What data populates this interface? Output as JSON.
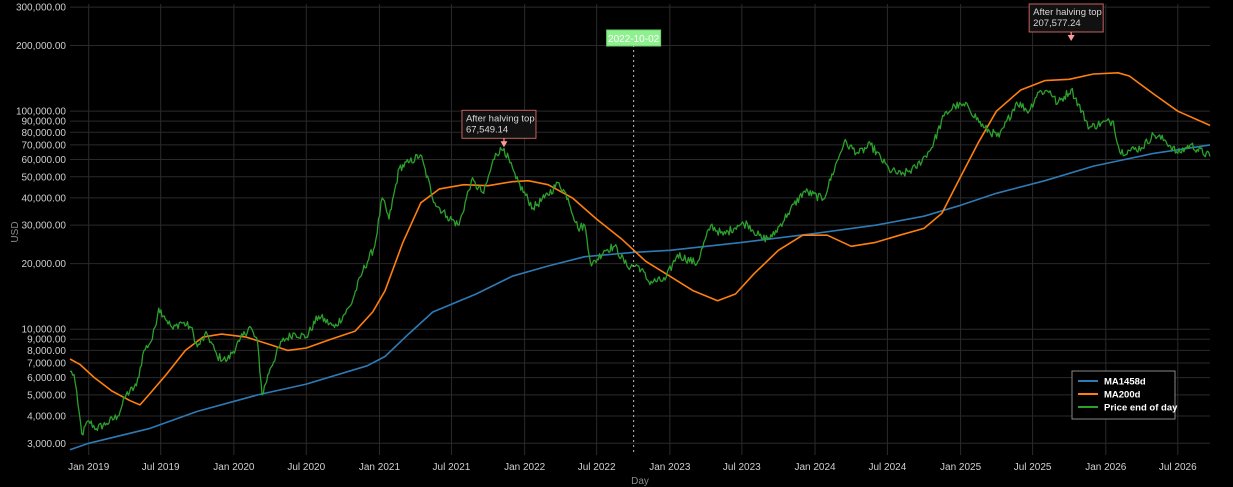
{
  "chart_data": {
    "type": "line",
    "xlabel": "Day",
    "ylabel": "USD",
    "y_scale": "log",
    "xlim": [
      "2018-11-15",
      "2026-09-20"
    ],
    "ylim": [
      2650,
      310000
    ],
    "grid": true,
    "legend_position": "bottom-right",
    "background": "#000000",
    "x_ticks": [
      {
        "date": "2019-01-01",
        "label": "Jan 2019"
      },
      {
        "date": "2019-07-01",
        "label": "Jul 2019"
      },
      {
        "date": "2020-01-01",
        "label": "Jan 2020"
      },
      {
        "date": "2020-07-01",
        "label": "Jul 2020"
      },
      {
        "date": "2021-01-01",
        "label": "Jan 2021"
      },
      {
        "date": "2021-07-01",
        "label": "Jul 2021"
      },
      {
        "date": "2022-01-01",
        "label": "Jan 2022"
      },
      {
        "date": "2022-07-01",
        "label": "Jul 2022"
      },
      {
        "date": "2023-01-01",
        "label": "Jan 2023"
      },
      {
        "date": "2023-07-01",
        "label": "Jul 2023"
      },
      {
        "date": "2024-01-01",
        "label": "Jan 2024"
      },
      {
        "date": "2024-07-01",
        "label": "Jul 2024"
      },
      {
        "date": "2025-01-01",
        "label": "Jan 2025"
      },
      {
        "date": "2025-07-01",
        "label": "Jul 2025"
      },
      {
        "date": "2026-01-01",
        "label": "Jan 2026"
      },
      {
        "date": "2026-07-01",
        "label": "Jul 2026"
      }
    ],
    "y_ticks": [
      {
        "value": 300000,
        "label": "300,000.00"
      },
      {
        "value": 200000,
        "label": "200,000.00"
      },
      {
        "value": 100000,
        "label": "100,000.00"
      },
      {
        "value": 90000,
        "label": "90,000.00"
      },
      {
        "value": 80000,
        "label": "80,000.00"
      },
      {
        "value": 70000,
        "label": "70,000.00"
      },
      {
        "value": 60000,
        "label": "60,000.00"
      },
      {
        "value": 50000,
        "label": "50,000.00"
      },
      {
        "value": 40000,
        "label": "40,000.00"
      },
      {
        "value": 30000,
        "label": "30,000.00"
      },
      {
        "value": 20000,
        "label": "20,000.00"
      },
      {
        "value": 10000,
        "label": "10,000.00"
      },
      {
        "value": 9000,
        "label": "9,000.00"
      },
      {
        "value": 8000,
        "label": "8,000.00"
      },
      {
        "value": 7000,
        "label": "7,000.00"
      },
      {
        "value": 6000,
        "label": "6,000.00"
      },
      {
        "value": 5000,
        "label": "5,000.00"
      },
      {
        "value": 4000,
        "label": "4,000.00"
      },
      {
        "value": 3000,
        "label": "3,000.00"
      }
    ],
    "series": [
      {
        "name": "MA1458d",
        "color": "#2e7ab5",
        "points": [
          [
            "2018-11-15",
            2800
          ],
          [
            "2019-01-01",
            3000
          ],
          [
            "2019-06-01",
            3500
          ],
          [
            "2019-10-01",
            4200
          ],
          [
            "2020-03-01",
            5000
          ],
          [
            "2020-07-01",
            5600
          ],
          [
            "2020-12-01",
            6800
          ],
          [
            "2021-01-15",
            7500
          ],
          [
            "2021-03-15",
            9500
          ],
          [
            "2021-05-15",
            12000
          ],
          [
            "2021-09-01",
            14500
          ],
          [
            "2021-12-01",
            17500
          ],
          [
            "2022-03-01",
            19500
          ],
          [
            "2022-06-01",
            21500
          ],
          [
            "2022-10-01",
            22500
          ],
          [
            "2023-01-01",
            23000
          ],
          [
            "2023-07-01",
            25000
          ],
          [
            "2024-01-01",
            27500
          ],
          [
            "2024-06-01",
            30000
          ],
          [
            "2024-10-01",
            33000
          ],
          [
            "2025-01-01",
            37000
          ],
          [
            "2025-04-01",
            42000
          ],
          [
            "2025-08-01",
            48000
          ],
          [
            "2025-12-01",
            56000
          ],
          [
            "2026-05-01",
            64000
          ],
          [
            "2026-09-20",
            70000
          ]
        ]
      },
      {
        "name": "MA200d",
        "color": "#ff7f0e",
        "points": [
          [
            "2018-11-15",
            7300
          ],
          [
            "2018-12-10",
            6900
          ],
          [
            "2019-01-15",
            6000
          ],
          [
            "2019-03-01",
            5200
          ],
          [
            "2019-04-15",
            4700
          ],
          [
            "2019-05-10",
            4500
          ],
          [
            "2019-06-01",
            5000
          ],
          [
            "2019-07-15",
            6200
          ],
          [
            "2019-09-01",
            8000
          ],
          [
            "2019-10-15",
            9200
          ],
          [
            "2019-12-01",
            9500
          ],
          [
            "2020-02-01",
            9200
          ],
          [
            "2020-04-01",
            8500
          ],
          [
            "2020-05-15",
            8000
          ],
          [
            "2020-07-01",
            8200
          ],
          [
            "2020-09-01",
            9000
          ],
          [
            "2020-11-01",
            9800
          ],
          [
            "2020-12-15",
            12000
          ],
          [
            "2021-01-15",
            15000
          ],
          [
            "2021-03-01",
            25000
          ],
          [
            "2021-04-15",
            38000
          ],
          [
            "2021-06-01",
            44000
          ],
          [
            "2021-08-01",
            46000
          ],
          [
            "2021-10-01",
            45500
          ],
          [
            "2021-12-01",
            47500
          ],
          [
            "2022-01-10",
            48000
          ],
          [
            "2022-03-01",
            46000
          ],
          [
            "2022-05-01",
            40000
          ],
          [
            "2022-07-01",
            32000
          ],
          [
            "2022-09-01",
            26000
          ],
          [
            "2022-11-01",
            20500
          ],
          [
            "2023-01-01",
            17500
          ],
          [
            "2023-03-01",
            15000
          ],
          [
            "2023-05-01",
            13500
          ],
          [
            "2023-06-15",
            14500
          ],
          [
            "2023-08-01",
            18000
          ],
          [
            "2023-10-01",
            23000
          ],
          [
            "2023-12-01",
            27000
          ],
          [
            "2024-02-01",
            27000
          ],
          [
            "2024-04-01",
            24000
          ],
          [
            "2024-06-01",
            25000
          ],
          [
            "2024-08-01",
            27000
          ],
          [
            "2024-10-01",
            29000
          ],
          [
            "2024-11-15",
            34000
          ],
          [
            "2025-01-01",
            50000
          ],
          [
            "2025-02-15",
            72000
          ],
          [
            "2025-04-01",
            100000
          ],
          [
            "2025-06-01",
            125000
          ],
          [
            "2025-08-01",
            138000
          ],
          [
            "2025-10-01",
            140000
          ],
          [
            "2025-12-01",
            148000
          ],
          [
            "2026-02-01",
            150000
          ],
          [
            "2026-03-01",
            145000
          ],
          [
            "2026-05-01",
            120000
          ],
          [
            "2026-07-01",
            100000
          ],
          [
            "2026-09-20",
            86000
          ]
        ]
      },
      {
        "name": "Price end of day",
        "color": "#2ca02c",
        "points": [
          [
            "2018-11-15",
            6400
          ],
          [
            "2018-11-25",
            6200
          ],
          [
            "2018-12-05",
            4500
          ],
          [
            "2018-12-15",
            3300
          ],
          [
            "2019-01-01",
            3800
          ],
          [
            "2019-01-20",
            3500
          ],
          [
            "2019-02-15",
            3700
          ],
          [
            "2019-03-15",
            4000
          ],
          [
            "2019-04-05",
            5000
          ],
          [
            "2019-05-01",
            5500
          ],
          [
            "2019-05-20",
            8000
          ],
          [
            "2019-06-10",
            9000
          ],
          [
            "2019-06-26",
            12500
          ],
          [
            "2019-07-10",
            11500
          ],
          [
            "2019-08-01",
            10000
          ],
          [
            "2019-08-20",
            10800
          ],
          [
            "2019-09-15",
            10200
          ],
          [
            "2019-10-01",
            8300
          ],
          [
            "2019-10-26",
            9500
          ],
          [
            "2019-11-20",
            7500
          ],
          [
            "2019-12-15",
            7200
          ],
          [
            "2020-01-15",
            8800
          ],
          [
            "2020-02-10",
            10300
          ],
          [
            "2020-03-01",
            8600
          ],
          [
            "2020-03-12",
            5000
          ],
          [
            "2020-04-01",
            6600
          ],
          [
            "2020-05-01",
            8800
          ],
          [
            "2020-06-01",
            9600
          ],
          [
            "2020-07-01",
            9200
          ],
          [
            "2020-08-01",
            11500
          ],
          [
            "2020-09-10",
            10200
          ],
          [
            "2020-10-20",
            12800
          ],
          [
            "2020-11-20",
            18500
          ],
          [
            "2020-12-20",
            24000
          ],
          [
            "2021-01-08",
            40000
          ],
          [
            "2021-01-25",
            32000
          ],
          [
            "2021-02-20",
            55000
          ],
          [
            "2021-03-15",
            58000
          ],
          [
            "2021-04-14",
            63000
          ],
          [
            "2021-05-20",
            38000
          ],
          [
            "2021-06-20",
            33000
          ],
          [
            "2021-07-20",
            30000
          ],
          [
            "2021-08-20",
            48000
          ],
          [
            "2021-09-20",
            42000
          ],
          [
            "2021-10-20",
            64000
          ],
          [
            "2021-11-10",
            67549
          ],
          [
            "2021-12-10",
            49000
          ],
          [
            "2022-01-22",
            36000
          ],
          [
            "2022-02-20",
            40000
          ],
          [
            "2022-03-28",
            47000
          ],
          [
            "2022-04-20",
            40000
          ],
          [
            "2022-05-15",
            29000
          ],
          [
            "2022-06-01",
            30000
          ],
          [
            "2022-06-18",
            19500
          ],
          [
            "2022-07-20",
            23000
          ],
          [
            "2022-08-15",
            24000
          ],
          [
            "2022-09-15",
            19500
          ],
          [
            "2022-10-15",
            19500
          ],
          [
            "2022-11-09",
            16500
          ],
          [
            "2022-12-20",
            16800
          ],
          [
            "2023-01-20",
            22000
          ],
          [
            "2023-03-10",
            20000
          ],
          [
            "2023-04-14",
            30000
          ],
          [
            "2023-05-15",
            27000
          ],
          [
            "2023-06-20",
            30000
          ],
          [
            "2023-07-15",
            30500
          ],
          [
            "2023-08-20",
            26000
          ],
          [
            "2023-09-15",
            26500
          ],
          [
            "2023-10-25",
            34000
          ],
          [
            "2023-12-05",
            43000
          ],
          [
            "2024-01-22",
            39500
          ],
          [
            "2024-03-14",
            72000
          ],
          [
            "2024-04-20",
            64000
          ],
          [
            "2024-05-20",
            70000
          ],
          [
            "2024-07-05",
            54000
          ],
          [
            "2024-08-05",
            51000
          ],
          [
            "2024-09-10",
            55000
          ],
          [
            "2024-10-20",
            68000
          ],
          [
            "2024-11-20",
            95000
          ],
          [
            "2024-12-17",
            106000
          ],
          [
            "2025-01-20",
            105000
          ],
          [
            "2025-02-28",
            84000
          ],
          [
            "2025-04-08",
            76000
          ],
          [
            "2025-05-22",
            110000
          ],
          [
            "2025-06-22",
            100000
          ],
          [
            "2025-07-14",
            122000
          ],
          [
            "2025-08-14",
            124000
          ],
          [
            "2025-09-01",
            108000
          ],
          [
            "2025-10-06",
            126000
          ],
          [
            "2025-11-21",
            84000
          ],
          [
            "2025-12-20",
            88000
          ],
          [
            "2026-01-20",
            90000
          ],
          [
            "2026-02-05",
            65000
          ],
          [
            "2026-03-01",
            66000
          ],
          [
            "2026-04-01",
            68000
          ],
          [
            "2026-05-01",
            78000
          ],
          [
            "2026-06-01",
            73000
          ],
          [
            "2026-07-01",
            64000
          ],
          [
            "2026-08-01",
            70000
          ],
          [
            "2026-09-20",
            62000
          ]
        ]
      }
    ],
    "annotations": [
      {
        "lines": [
          "After halving top",
          "67,549.14"
        ],
        "date": "2021-11-10",
        "value": 67549.14
      },
      {
        "lines": [
          "After halving top",
          "207,577.24"
        ],
        "date": "2025-10-06",
        "value": 207577.24
      }
    ],
    "vertical_marker": {
      "date": "2022-10-02",
      "label": "2022-10-02"
    },
    "legend": [
      "MA1458d",
      "MA200d",
      "Price end of day"
    ]
  }
}
